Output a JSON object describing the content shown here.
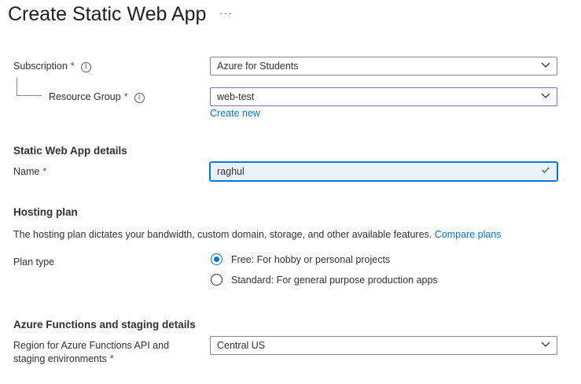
{
  "page": {
    "title": "Create Static Web App",
    "more": "···"
  },
  "form": {
    "subscription": {
      "label": "Subscription",
      "required": "*",
      "info": "i",
      "value": "Azure for Students"
    },
    "resource_group": {
      "label": "Resource Group",
      "required": "*",
      "info": "i",
      "value": "web-test",
      "create_new": "Create new"
    },
    "details": {
      "heading": "Static Web App details",
      "name_label": "Name",
      "name_required": "*",
      "name_value": "raghul"
    },
    "hosting": {
      "heading": "Hosting plan",
      "description": "The hosting plan dictates your bandwidth, custom domain, storage, and other available features.",
      "compare_link": "Compare plans",
      "plan_type_label": "Plan type",
      "options": [
        {
          "label": "Free: For hobby or personal projects",
          "selected": true
        },
        {
          "label": "Standard: For general purpose production apps",
          "selected": false
        }
      ]
    },
    "functions": {
      "heading": "Azure Functions and staging details",
      "region_label_line1": "Region for Azure Functions API and",
      "region_label_line2": "staging environments",
      "region_required": "*",
      "region_value": "Central US"
    }
  },
  "colors": {
    "accent": "#0078d4",
    "required": "#a4262c",
    "focus_border": "#8764b8",
    "valid_check": "#107c10"
  }
}
